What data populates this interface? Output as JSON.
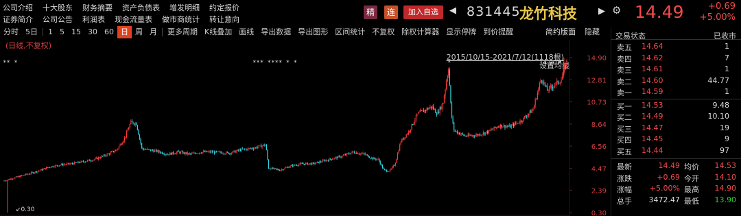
{
  "nav": {
    "row1": [
      "公司介绍",
      "十大股东",
      "财务摘要",
      "资产负债表",
      "增发明细",
      "约定报价"
    ],
    "row2": [
      "证券简介",
      "公司公告",
      "利润表",
      "现金流量表",
      "做市商统计",
      "转让意向"
    ]
  },
  "header": {
    "tag_jing": "精",
    "tag_lian": "连",
    "add_fav": "加入自选",
    "code": "831445",
    "name": "龙竹科技",
    "price": "14.49",
    "change_abs": "+0.69",
    "change_pct": "+5.00%",
    "colors": {
      "up": "#f24b4b",
      "name": "#e8c74a",
      "accent": "#e0421f"
    }
  },
  "toolbar": {
    "items": [
      "分时",
      "5日",
      "1",
      "5",
      "15",
      "30",
      "60",
      "日",
      "周",
      "月",
      "更多周期",
      "K线叠加",
      "画线",
      "导出数据",
      "导出图形",
      "区间统计",
      "不复权",
      "除权计算器",
      "显示停牌",
      "到价提醒"
    ],
    "active": "日",
    "simple_view": "简约版面",
    "hide": "隐藏"
  },
  "chart_info": {
    "adjust_note": "(日线,不复权)",
    "range": "2015/10/15-2021/7/12(1118根)",
    "set_ma": "设置均线",
    "high_label": "14.90",
    "low_label": "0.30",
    "markers_left": "** *",
    "markers_mid": "*** **** * *"
  },
  "chart_data": {
    "type": "candlestick",
    "title": "",
    "y_ticks": [
      "14.90",
      "12.81",
      "10.73",
      "8.64",
      "6.56",
      "4.47",
      "2.39",
      "0.30"
    ],
    "ylim": [
      0.3,
      14.9
    ],
    "x_range": [
      "2015/10/15",
      "2021/7/12"
    ],
    "bar_count": 1118,
    "period_max": 14.9,
    "period_min": 0.3,
    "last_close": 14.49,
    "close_path": [
      [
        0,
        3.3
      ],
      [
        0.02,
        3.6
      ],
      [
        0.04,
        3.9
      ],
      [
        0.06,
        4.2
      ],
      [
        0.08,
        4.6
      ],
      [
        0.1,
        4.8
      ],
      [
        0.12,
        4.9
      ],
      [
        0.14,
        5.1
      ],
      [
        0.16,
        5.3
      ],
      [
        0.18,
        5.7
      ],
      [
        0.2,
        6.2
      ],
      [
        0.215,
        7.4
      ],
      [
        0.225,
        8.8
      ],
      [
        0.235,
        8.7
      ],
      [
        0.245,
        6.3
      ],
      [
        0.27,
        6.1
      ],
      [
        0.29,
        5.8
      ],
      [
        0.31,
        6.0
      ],
      [
        0.33,
        5.8
      ],
      [
        0.35,
        6.0
      ],
      [
        0.37,
        6.0
      ],
      [
        0.4,
        5.9
      ],
      [
        0.42,
        6.2
      ],
      [
        0.445,
        6.4
      ],
      [
        0.465,
        6.7
      ],
      [
        0.47,
        4.5
      ],
      [
        0.49,
        4.3
      ],
      [
        0.51,
        4.7
      ],
      [
        0.53,
        4.9
      ],
      [
        0.55,
        4.9
      ],
      [
        0.57,
        5.2
      ],
      [
        0.6,
        5.6
      ],
      [
        0.62,
        6.0
      ],
      [
        0.64,
        5.8
      ],
      [
        0.655,
        5.4
      ],
      [
        0.665,
        5.3
      ],
      [
        0.675,
        4.3
      ],
      [
        0.685,
        4.2
      ],
      [
        0.695,
        4.9
      ],
      [
        0.705,
        7.0
      ],
      [
        0.72,
        8.0
      ],
      [
        0.735,
        9.6
      ],
      [
        0.75,
        10.0
      ],
      [
        0.76,
        10.3
      ],
      [
        0.77,
        9.6
      ],
      [
        0.78,
        10.6
      ],
      [
        0.79,
        14.0
      ],
      [
        0.795,
        9.5
      ],
      [
        0.8,
        8.0
      ],
      [
        0.82,
        7.5
      ],
      [
        0.84,
        7.6
      ],
      [
        0.86,
        7.9
      ],
      [
        0.88,
        8.5
      ],
      [
        0.9,
        8.4
      ],
      [
        0.92,
        9.0
      ],
      [
        0.94,
        10.0
      ],
      [
        0.955,
        13.0
      ],
      [
        0.965,
        11.8
      ],
      [
        0.98,
        12.4
      ],
      [
        0.99,
        12.8
      ],
      [
        1.0,
        14.49
      ]
    ]
  },
  "orderbook": {
    "header_left": "交易状态",
    "header_right": "已收市",
    "asks": [
      {
        "label": "卖五",
        "price": "14.64",
        "vol": "1"
      },
      {
        "label": "卖四",
        "price": "14.62",
        "vol": "7"
      },
      {
        "label": "卖三",
        "price": "14.61",
        "vol": "1"
      },
      {
        "label": "卖二",
        "price": "14.60",
        "vol": "44.77"
      },
      {
        "label": "卖一",
        "price": "14.59",
        "vol": "1"
      }
    ],
    "bids": [
      {
        "label": "买一",
        "price": "14.53",
        "vol": "9.48"
      },
      {
        "label": "买二",
        "price": "14.49",
        "vol": "10.10"
      },
      {
        "label": "买三",
        "price": "14.47",
        "vol": "19"
      },
      {
        "label": "买四",
        "price": "14.45",
        "vol": "9"
      },
      {
        "label": "买五",
        "price": "14.44",
        "vol": "97"
      }
    ]
  },
  "stats": [
    {
      "k1": "最新",
      "v1": "14.49",
      "k2": "均价",
      "v2": "14.53"
    },
    {
      "k1": "涨跌",
      "v1": "+0.69",
      "k2": "今开",
      "v2": "14.10"
    },
    {
      "k1": "涨幅",
      "v1": "+5.00%",
      "k2": "最高",
      "v2": "14.90"
    },
    {
      "k1": "总手",
      "v1": "3472.47",
      "k2": "最低",
      "v2": "13.90"
    }
  ]
}
